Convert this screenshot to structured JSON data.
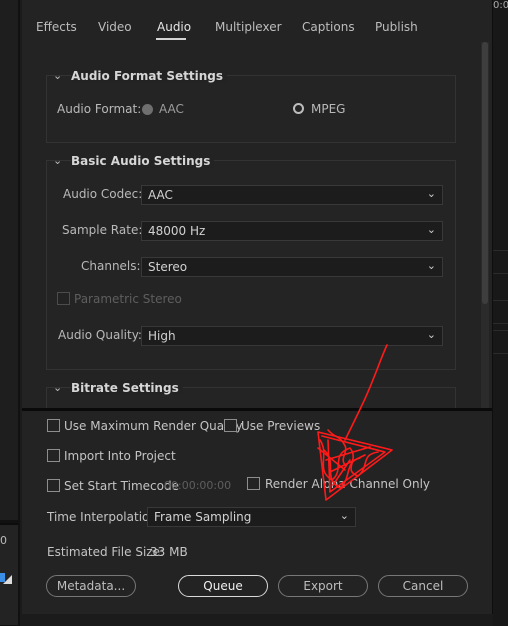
{
  "left_strip": {
    "value": "0"
  },
  "right_strip": {
    "timecode": "0:0"
  },
  "tabs": [
    "Effects",
    "Video",
    "Audio",
    "Multiplexer",
    "Captions",
    "Publish"
  ],
  "active_tab": "Audio",
  "audio_format": {
    "title": "Audio Format Settings",
    "label": "Audio Format:",
    "options": [
      "AAC",
      "MPEG"
    ],
    "selected": "AAC"
  },
  "basic_audio": {
    "title": "Basic Audio Settings",
    "codec_label": "Audio Codec:",
    "codec": "AAC",
    "sample_rate_label": "Sample Rate:",
    "sample_rate": "48000 Hz",
    "channels_label": "Channels:",
    "channels": "Stereo",
    "parametric_label": "Parametric Stereo",
    "quality_label": "Audio Quality:",
    "quality": "High"
  },
  "bitrate": {
    "title": "Bitrate Settings"
  },
  "bottom": {
    "max_render": "Use Maximum Render Quality",
    "use_previews": "Use Previews",
    "import_project": "Import Into Project",
    "set_start_timecode": "Set Start Timecode",
    "timecode_value": "00:00:00:00",
    "render_alpha": "Render Alpha Channel Only",
    "time_interp_label": "Time Interpolation:",
    "time_interp": "Frame Sampling",
    "file_size_label": "Estimated File Size:",
    "file_size": "33 MB"
  },
  "buttons": {
    "metadata": "Metadata...",
    "queue": "Queue",
    "export": "Export",
    "cancel": "Cancel"
  },
  "colors": {
    "annotation": "#ff1a1a",
    "accent": "#dadada"
  }
}
